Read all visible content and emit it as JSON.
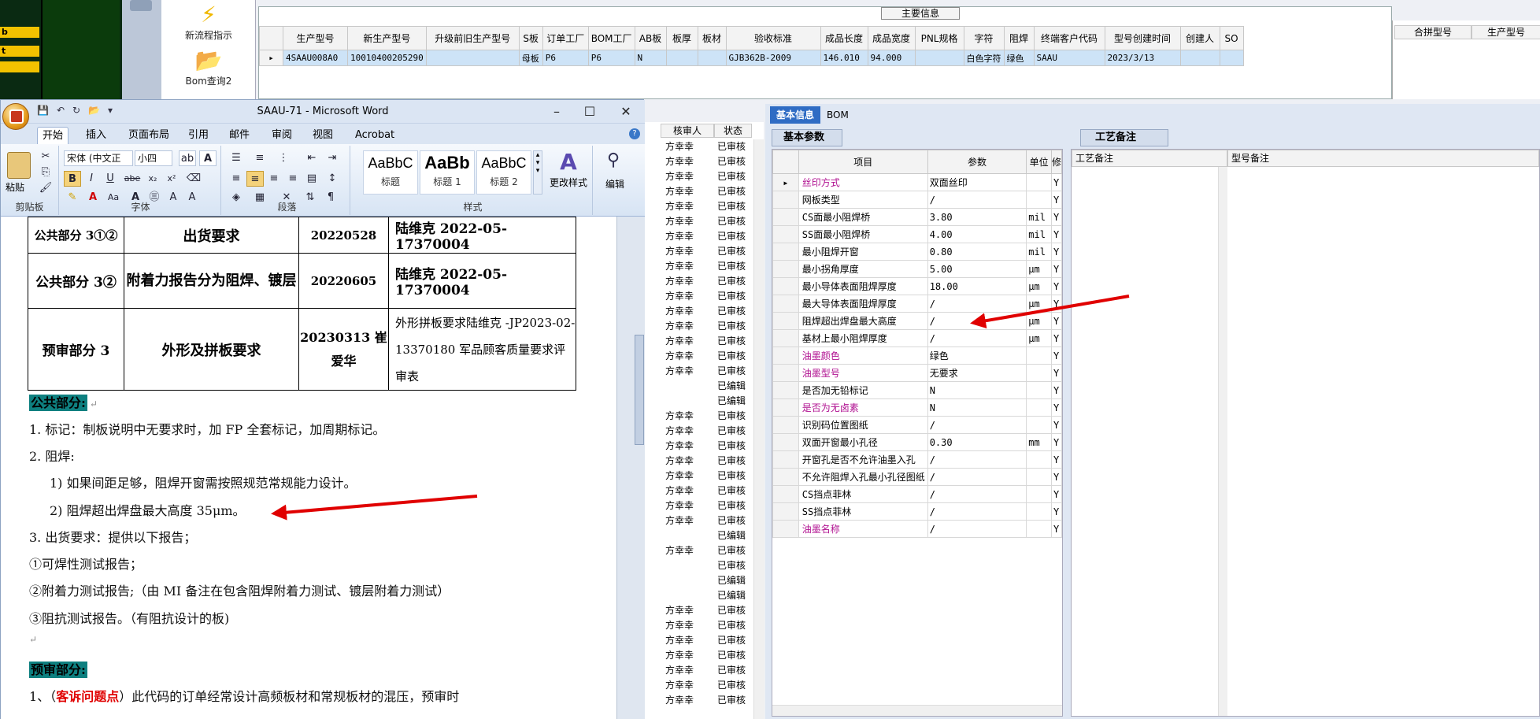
{
  "launcher": {
    "items": [
      {
        "label": "新流程指示",
        "icon": "lightning-icon"
      },
      {
        "label": "Bom查询2",
        "icon": "folder-icon"
      }
    ]
  },
  "left_strip": {
    "labels": [
      "b",
      "t"
    ]
  },
  "main_grid": {
    "caption": "主要信息",
    "columns": [
      "生产型号",
      "新生产型号",
      "升级前旧生产型号",
      "S板",
      "订单工厂",
      "BOM工厂",
      "AB板",
      "板厚",
      "板材",
      "验收标准",
      "成品长度",
      "成品宽度",
      "PNL规格",
      "字符",
      "阻焊",
      "终端客户代码",
      "型号创建时间",
      "创建人",
      "SO"
    ],
    "row": [
      "4SAAU008A0",
      "10010400205290",
      "",
      "母板",
      "P6",
      "P6",
      "N",
      "",
      "",
      "GJB362B-2009",
      "146.010",
      "94.000",
      "",
      "白色字符",
      "绿色",
      "SAAU",
      "2023/3/13",
      "",
      ""
    ]
  },
  "right_grid": {
    "columns": [
      "合拼型号",
      "生产型号"
    ]
  },
  "word": {
    "title": "SAAU-71 - Microsoft Word",
    "tabs": [
      "开始",
      "插入",
      "页面布局",
      "引用",
      "邮件",
      "审阅",
      "视图",
      "Acrobat"
    ],
    "ribbon": {
      "paste": "粘贴",
      "clipboard": "剪贴板",
      "font_name": "宋体 (中文正",
      "font_size": "小四",
      "font_group": "字体",
      "paragraph_group": "段落",
      "styles": [
        {
          "preview": "AaBbC",
          "name": "标题"
        },
        {
          "preview": "AaBb",
          "name": "标题 1"
        },
        {
          "preview": "AaBbC",
          "name": "标题 2"
        }
      ],
      "change_styles": "更改样式",
      "styles_group": "样式",
      "edit": "编辑"
    },
    "table": [
      [
        "公共部分 3①②",
        "出货要求",
        "20220528",
        "陆维克 2022-05-17370004"
      ],
      [
        "公共部分 3②",
        "附着力报告分为阻焊、镀层",
        "20220605",
        "陆维克 2022-05-17370004"
      ],
      [
        "预审部分 3",
        "外形及拼板要求",
        "20230313 崔爱华",
        "外形拼板要求陆维克 -JP2023-02-13370180 军品顾客质量要求评审表"
      ]
    ],
    "body": {
      "h1": "公共部分:",
      "p1": "1. 标记：制板说明中无要求时，加 FP 全套标记，加周期标记。",
      "p2": "2. 阻焊:",
      "p3": "1) 如果间距足够，阻焊开窗需按照规范常规能力设计。",
      "p4": "2) 阻焊超出焊盘最大高度 35μm。",
      "p5": "3. 出货要求：提供以下报告；",
      "p6": "①可焊性测试报告；",
      "p7": "②附着力测试报告;（由 MI 备注在包含阻焊附着力测试、镀层附着力测试）",
      "p8": "③阻抗测试报告。（有阻抗设计的板)",
      "h2": "预审部分:",
      "p9_pre": "1、（",
      "p9_red": "客诉问题点",
      "p9_post": "）此代码的订单经常设计高频板材和常规板材的混压，预审时"
    }
  },
  "review_list": {
    "columns": [
      "核审人",
      "状态"
    ],
    "rows": [
      [
        "方幸幸",
        "已审核"
      ],
      [
        "方幸幸",
        "已审核"
      ],
      [
        "方幸幸",
        "已审核"
      ],
      [
        "方幸幸",
        "已审核"
      ],
      [
        "方幸幸",
        "已审核"
      ],
      [
        "方幸幸",
        "已审核"
      ],
      [
        "方幸幸",
        "已审核"
      ],
      [
        "方幸幸",
        "已审核"
      ],
      [
        "方幸幸",
        "已审核"
      ],
      [
        "方幸幸",
        "已审核"
      ],
      [
        "方幸幸",
        "已审核"
      ],
      [
        "方幸幸",
        "已审核"
      ],
      [
        "方幸幸",
        "已审核"
      ],
      [
        "方幸幸",
        "已审核"
      ],
      [
        "方幸幸",
        "已审核"
      ],
      [
        "方幸幸",
        "已审核"
      ],
      [
        "",
        "已编辑"
      ],
      [
        "",
        "已编辑"
      ],
      [
        "方幸幸",
        "已审核"
      ],
      [
        "方幸幸",
        "已审核"
      ],
      [
        "方幸幸",
        "已审核"
      ],
      [
        "方幸幸",
        "已审核"
      ],
      [
        "方幸幸",
        "已审核"
      ],
      [
        "方幸幸",
        "已审核"
      ],
      [
        "方幸幸",
        "已审核"
      ],
      [
        "方幸幸",
        "已审核"
      ],
      [
        "",
        "已编辑"
      ],
      [
        "方幸幸",
        "已审核"
      ],
      [
        "",
        "已审核"
      ],
      [
        "",
        "已编辑"
      ],
      [
        "",
        "已编辑"
      ],
      [
        "方幸幸",
        "已审核"
      ],
      [
        "方幸幸",
        "已审核"
      ],
      [
        "方幸幸",
        "已审核"
      ],
      [
        "方幸幸",
        "已审核"
      ],
      [
        "方幸幸",
        "已审核"
      ],
      [
        "方幸幸",
        "已审核"
      ],
      [
        "方幸幸",
        "已审核"
      ]
    ]
  },
  "detail": {
    "tabs": [
      "基本信息",
      "BOM"
    ],
    "sub_tab": "基本参数",
    "columns": [
      "项目",
      "参数",
      "单位",
      "修"
    ],
    "rows": [
      {
        "item": "丝印方式",
        "value": "双面丝印",
        "unit": "",
        "flag": "Y",
        "mag": true
      },
      {
        "item": "网板类型",
        "value": "/",
        "unit": "",
        "flag": "Y",
        "mag": false
      },
      {
        "item": "CS面最小阻焊桥",
        "value": "3.80",
        "unit": "mil",
        "flag": "Y",
        "mag": false
      },
      {
        "item": "SS面最小阻焊桥",
        "value": "4.00",
        "unit": "mil",
        "flag": "Y",
        "mag": false
      },
      {
        "item": "最小阻焊开窗",
        "value": "0.80",
        "unit": "mil",
        "flag": "Y",
        "mag": false
      },
      {
        "item": "最小拐角厚度",
        "value": "5.00",
        "unit": "μm",
        "flag": "Y",
        "mag": false
      },
      {
        "item": "最小导体表面阻焊厚度",
        "value": "18.00",
        "unit": "μm",
        "flag": "Y",
        "mag": false
      },
      {
        "item": "最大导体表面阻焊厚度",
        "value": "/",
        "unit": "μm",
        "flag": "Y",
        "mag": false
      },
      {
        "item": "阻焊超出焊盘最大高度",
        "value": "/",
        "unit": "μm",
        "flag": "Y",
        "mag": false
      },
      {
        "item": "基材上最小阻焊厚度",
        "value": "/",
        "unit": "μm",
        "flag": "Y",
        "mag": false
      },
      {
        "item": "油墨颜色",
        "value": "绿色",
        "unit": "",
        "flag": "Y",
        "mag": true
      },
      {
        "item": "油墨型号",
        "value": "无要求",
        "unit": "",
        "flag": "Y",
        "mag": true
      },
      {
        "item": "是否加无铅标记",
        "value": "N",
        "unit": "",
        "flag": "Y",
        "mag": false
      },
      {
        "item": "是否为无卤素",
        "value": "N",
        "unit": "",
        "flag": "Y",
        "mag": true
      },
      {
        "item": "识别码位置图纸",
        "value": "/",
        "unit": "",
        "flag": "Y",
        "mag": false
      },
      {
        "item": "双面开窗最小孔径",
        "value": "0.30",
        "unit": "mm",
        "flag": "Y",
        "mag": false
      },
      {
        "item": "开窗孔是否不允许油墨入孔",
        "value": "/",
        "unit": "",
        "flag": "Y",
        "mag": false
      },
      {
        "item": "不允许阻焊入孔最小孔径图纸",
        "value": "/",
        "unit": "",
        "flag": "Y",
        "mag": false
      },
      {
        "item": "CS挡点菲林",
        "value": "/",
        "unit": "",
        "flag": "Y",
        "mag": false
      },
      {
        "item": "SS挡点菲林",
        "value": "/",
        "unit": "",
        "flag": "Y",
        "mag": false
      },
      {
        "item": "油墨名称",
        "value": "/",
        "unit": "",
        "flag": "Y",
        "mag": true
      }
    ]
  },
  "notes": {
    "tab": "工艺备注",
    "columns": [
      "工艺备注",
      "型号备注"
    ]
  },
  "colors": {
    "accent": "#2f6cc4",
    "highlight": "#0e8080",
    "arrow": "#e00000",
    "magenta_text": "#b01090"
  }
}
